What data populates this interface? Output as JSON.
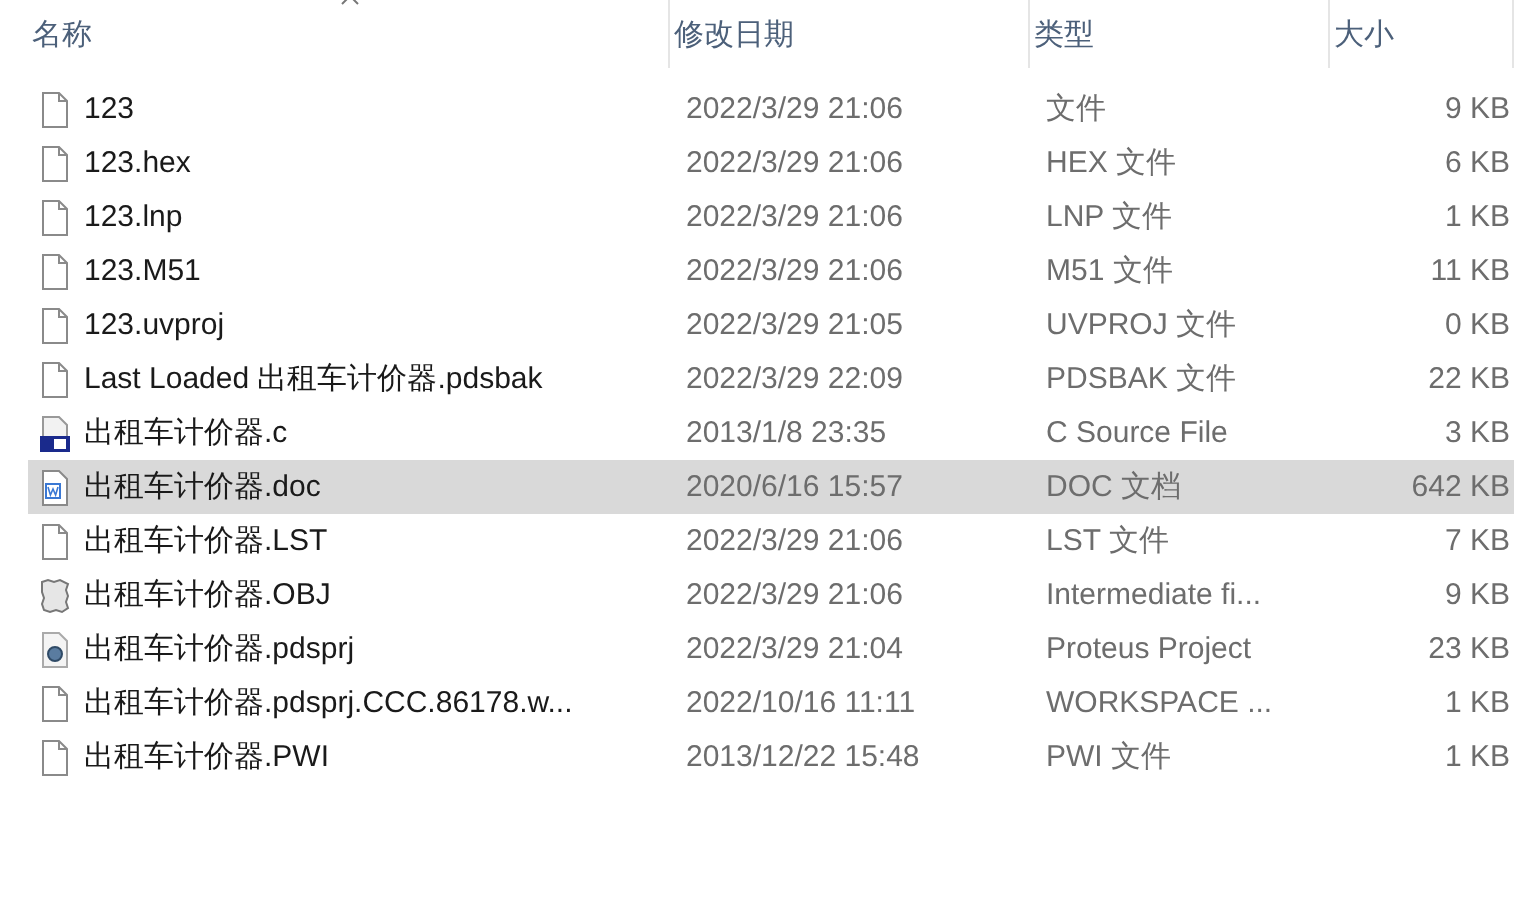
{
  "columns": [
    {
      "label": "名称",
      "sorted": true
    },
    {
      "label": "修改日期",
      "sorted": false
    },
    {
      "label": "类型",
      "sorted": false
    },
    {
      "label": "大小",
      "sorted": false
    }
  ],
  "rows": [
    {
      "name": "123",
      "date": "2022/3/29 21:06",
      "type": "文件",
      "size": "9 KB",
      "kind": "blank",
      "selected": false
    },
    {
      "name": "123.hex",
      "date": "2022/3/29 21:06",
      "type": "HEX 文件",
      "size": "6 KB",
      "kind": "blank",
      "selected": false
    },
    {
      "name": "123.lnp",
      "date": "2022/3/29 21:06",
      "type": "LNP 文件",
      "size": "1 KB",
      "kind": "blank",
      "selected": false
    },
    {
      "name": "123.M51",
      "date": "2022/3/29 21:06",
      "type": "M51 文件",
      "size": "11 KB",
      "kind": "blank",
      "selected": false
    },
    {
      "name": "123.uvproj",
      "date": "2022/3/29 21:05",
      "type": "UVPROJ 文件",
      "size": "0 KB",
      "kind": "blank",
      "selected": false
    },
    {
      "name": "Last Loaded 出租车计价器.pdsbak",
      "date": "2022/3/29 22:09",
      "type": "PDSBAK 文件",
      "size": "22 KB",
      "kind": "blank",
      "selected": false
    },
    {
      "name": "出租车计价器.c",
      "date": "2013/1/8 23:35",
      "type": "C Source File",
      "size": "3 KB",
      "kind": "csource",
      "selected": false
    },
    {
      "name": "出租车计价器.doc",
      "date": "2020/6/16 15:57",
      "type": "DOC 文档",
      "size": "642 KB",
      "kind": "word",
      "selected": true
    },
    {
      "name": "出租车计价器.LST",
      "date": "2022/3/29 21:06",
      "type": "LST 文件",
      "size": "7 KB",
      "kind": "blank",
      "selected": false
    },
    {
      "name": "出租车计价器.OBJ",
      "date": "2022/3/29 21:06",
      "type": "Intermediate fi...",
      "size": "9 KB",
      "kind": "obj",
      "selected": false
    },
    {
      "name": "出租车计价器.pdsprj",
      "date": "2022/3/29 21:04",
      "type": "Proteus Project",
      "size": "23 KB",
      "kind": "proteus",
      "selected": false
    },
    {
      "name": "出租车计价器.pdsprj.CCC.86178.w...",
      "date": "2022/10/16 11:11",
      "type": "WORKSPACE ...",
      "size": "1 KB",
      "kind": "blank",
      "selected": false
    },
    {
      "name": "出租车计价器.PWI",
      "date": "2013/12/22 15:48",
      "type": "PWI 文件",
      "size": "1 KB",
      "kind": "blank",
      "selected": false
    }
  ]
}
